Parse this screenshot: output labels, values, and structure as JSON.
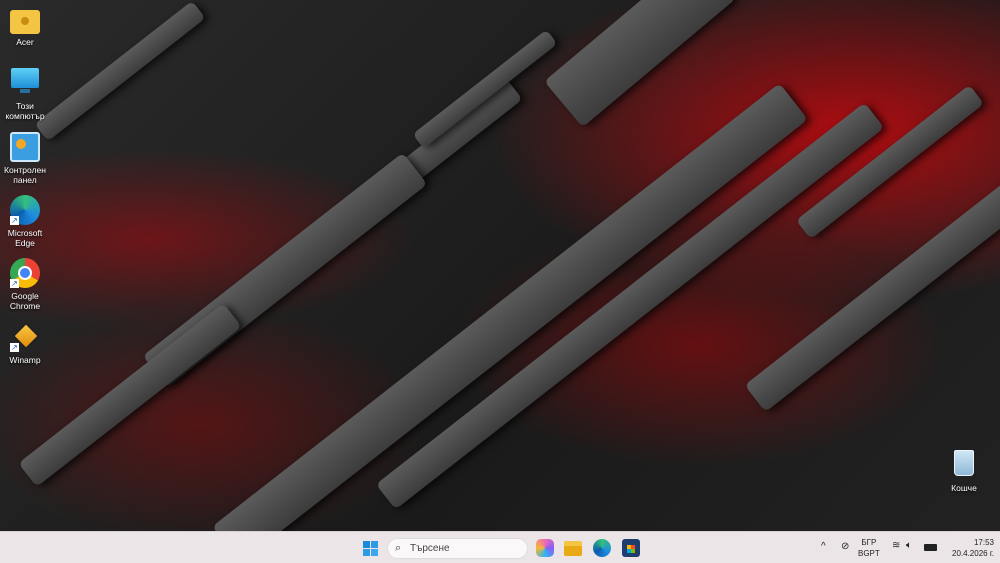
{
  "desktop": {
    "icons": [
      {
        "label": "Acer",
        "icon": "folder-user-icon"
      },
      {
        "label": "Този компютър",
        "icon": "monitor-icon"
      },
      {
        "label": "Контролен панел",
        "icon": "control-panel-icon"
      },
      {
        "label": "Microsoft Edge",
        "icon": "edge-icon"
      },
      {
        "label": "Google Chrome",
        "icon": "chrome-icon"
      },
      {
        "label": "Winamp",
        "icon": "winamp-icon"
      }
    ],
    "recycle_bin": {
      "label": "Кошче",
      "icon": "recycle-bin-icon"
    }
  },
  "taskbar": {
    "search_placeholder": "Търсене",
    "apps": [
      "start-icon",
      "copilot-icon",
      "file-explorer-icon",
      "edge-icon",
      "store-icon"
    ],
    "tray": {
      "lang_top": "БГР",
      "lang_bottom": "BGPT",
      "time": "17:53",
      "date": "20.4.2026 г."
    }
  },
  "colors": {
    "taskbar": "#ece5e7",
    "accent_red": "#c80a0f"
  }
}
